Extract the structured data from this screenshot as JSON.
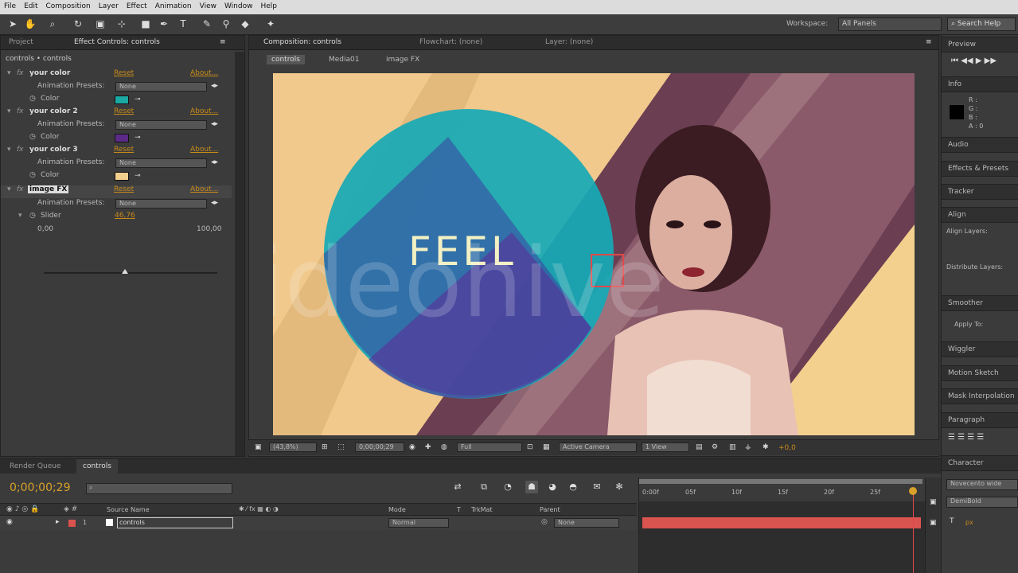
{
  "menu": [
    "File",
    "Edit",
    "Composition",
    "Layer",
    "Effect",
    "Animation",
    "View",
    "Window",
    "Help"
  ],
  "toolbar": {
    "workspace_label": "Workspace:",
    "workspace_value": "All Panels",
    "search_help": "Search Help"
  },
  "left_panel": {
    "tabs": [
      "Project",
      "Effect Controls: controls"
    ],
    "breadcrumb": "controls • controls",
    "effects": [
      {
        "name": "your color",
        "reset": "Reset",
        "about": "About...",
        "preset_label": "Animation Presets:",
        "preset_value": "None",
        "prop_label": "Color",
        "swatch": "#1aa9a3"
      },
      {
        "name": "your color 2",
        "reset": "Reset",
        "about": "About...",
        "preset_label": "Animation Presets:",
        "preset_value": "None",
        "prop_label": "Color",
        "swatch": "#5b2a86"
      },
      {
        "name": "your color 3",
        "reset": "Reset",
        "about": "About...",
        "preset_label": "Animation Presets:",
        "preset_value": "None",
        "prop_label": "Color",
        "swatch": "#f3d08e"
      }
    ],
    "image_fx": {
      "name": "image FX",
      "reset": "Reset",
      "about": "About...",
      "preset_label": "Animation Presets:",
      "preset_value": "None",
      "slider_label": "Slider",
      "slider_value": "46,76",
      "slider_min": "0,00",
      "slider_max": "100,00",
      "slider_fraction": 0.4676
    }
  },
  "comp_panel": {
    "tabs": [
      "Composition: controls",
      "Flowchart: (none)",
      "Layer: (none)"
    ],
    "breadcrumbs": [
      "controls",
      "Media01",
      "image FX"
    ],
    "feel_text": "FEEL",
    "watermark": "videohive",
    "footer": {
      "zoom": "(43,8%)",
      "timecode": "0;00;00;29",
      "resolution": "Full",
      "camera": "Active Camera",
      "view": "1 View",
      "exposure": "+0,0"
    }
  },
  "right_panel": {
    "sections": [
      "Preview",
      "Info",
      "Audio",
      "Effects & Presets",
      "Tracker",
      "Align",
      "Smoother",
      "Wiggler",
      "Motion Sketch",
      "Mask Interpolation",
      "Paragraph",
      "Character"
    ],
    "info_values": [
      "R :",
      "G :",
      "B :",
      "A : 0"
    ],
    "align_layers": "Align Layers:",
    "distribute_layers": "Distribute Layers:",
    "apply_to": "Apply To:",
    "font_family": "Novecento wide",
    "font_style": "DemiBold",
    "font_size_unit": "px"
  },
  "timeline": {
    "tabs": [
      "Render Queue",
      "controls"
    ],
    "timecode": "0;00;00;29",
    "columns": {
      "source": "Source Name",
      "mode": "Mode",
      "t": "T",
      "trkmat": "TrkMat",
      "parent": "Parent"
    },
    "layer": {
      "index": "1",
      "name": "controls",
      "mode": "Normal",
      "parent": "None"
    },
    "ruler": [
      "0:00f",
      "05f",
      "10f",
      "15f",
      "20f",
      "25f"
    ]
  },
  "colors": {
    "accent": "#c98c1a",
    "timecode": "#d8a12a",
    "layer_bar": "#d9534f"
  }
}
